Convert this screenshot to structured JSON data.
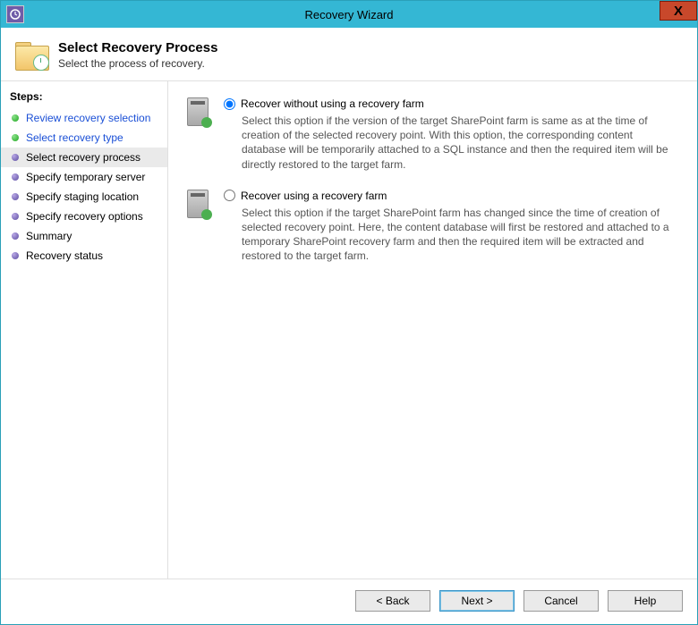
{
  "window": {
    "title": "Recovery Wizard",
    "close_glyph": "X"
  },
  "header": {
    "title": "Select Recovery Process",
    "subtitle": "Select the process of recovery."
  },
  "sidebar": {
    "title": "Steps:",
    "items": [
      {
        "label": "Review recovery selection",
        "state": "done"
      },
      {
        "label": "Select recovery type",
        "state": "done"
      },
      {
        "label": "Select recovery process",
        "state": "current"
      },
      {
        "label": "Specify temporary server",
        "state": "upcoming"
      },
      {
        "label": "Specify staging location",
        "state": "upcoming"
      },
      {
        "label": "Specify recovery options",
        "state": "upcoming"
      },
      {
        "label": "Summary",
        "state": "upcoming"
      },
      {
        "label": "Recovery status",
        "state": "upcoming"
      }
    ]
  },
  "options": [
    {
      "label": "Recover without using a recovery farm",
      "selected": true,
      "description": "Select this option if the version of the target SharePoint farm is same as at the time of creation of the selected recovery point. With this option, the corresponding content database will be temporarily attached to a SQL instance and then the required item will be directly restored to the target farm."
    },
    {
      "label": "Recover using a recovery farm",
      "selected": false,
      "description": "Select this option if the target SharePoint farm has changed since the time of creation of selected recovery point. Here, the content database will first be restored and attached to a temporary SharePoint recovery farm and then the required item will be extracted and restored to the target farm."
    }
  ],
  "buttons": {
    "back": "< Back",
    "next": "Next >",
    "cancel": "Cancel",
    "help": "Help"
  }
}
